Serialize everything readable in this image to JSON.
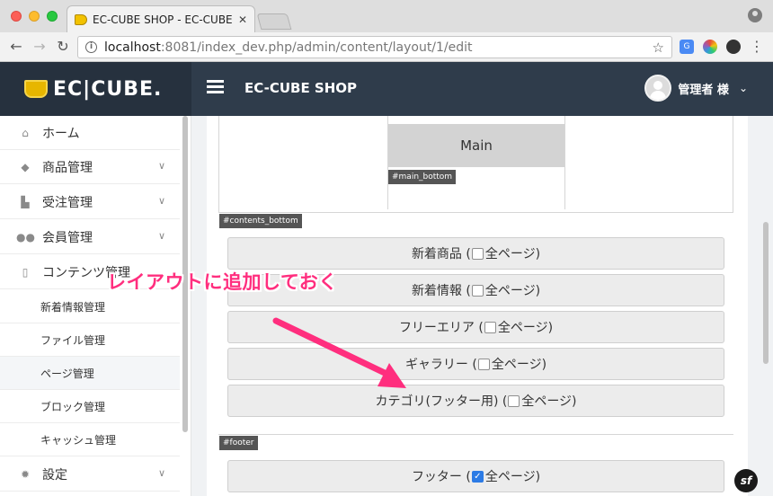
{
  "browser": {
    "tab_title": "EC-CUBE SHOP - EC-CUBE管",
    "url_host": "localhost",
    "url_rest": ":8081/index_dev.php/admin/content/layout/1/edit"
  },
  "header": {
    "logo_text": "EC|CUBE.",
    "shop_name": "EC-CUBE SHOP",
    "user_name": "管理者 様"
  },
  "sidebar": {
    "items": [
      {
        "label": "ホーム",
        "icon": "home-icon"
      },
      {
        "label": "商品管理",
        "icon": "tag-icon"
      },
      {
        "label": "受注管理",
        "icon": "cart-icon"
      },
      {
        "label": "会員管理",
        "icon": "users-icon"
      },
      {
        "label": "コンテンツ管理",
        "icon": "file-icon"
      },
      {
        "label": "設定",
        "icon": "gear-icon"
      }
    ],
    "subitems": [
      {
        "label": "新着情報管理"
      },
      {
        "label": "ファイル管理"
      },
      {
        "label": "ページ管理",
        "active": true
      },
      {
        "label": "ブロック管理"
      },
      {
        "label": "キャッシュ管理"
      }
    ]
  },
  "layout": {
    "main_label": "Main",
    "tags": {
      "main_bottom": "#main_bottom",
      "contents_bottom": "#contents_bottom",
      "footer": "#footer"
    },
    "contents_bottom_blocks": [
      {
        "label": "新着商品 (",
        "suffix": "全ページ)",
        "checked": false
      },
      {
        "label": "新着情報 (",
        "suffix": "全ページ)",
        "checked": false
      },
      {
        "label": "フリーエリア (",
        "suffix": "全ページ)",
        "checked": false
      },
      {
        "label": "ギャラリー (",
        "suffix": "全ページ)",
        "checked": false
      },
      {
        "label": "カテゴリ(フッター用) (",
        "suffix": "全ページ)",
        "checked": false
      }
    ],
    "footer_blocks": [
      {
        "label": "フッター (",
        "suffix": "全ページ)",
        "checked": true
      }
    ]
  },
  "annotation": {
    "text": "レイアウトに追加しておく",
    "color": "#ff2e7e"
  },
  "badge": {
    "text": "sf"
  }
}
